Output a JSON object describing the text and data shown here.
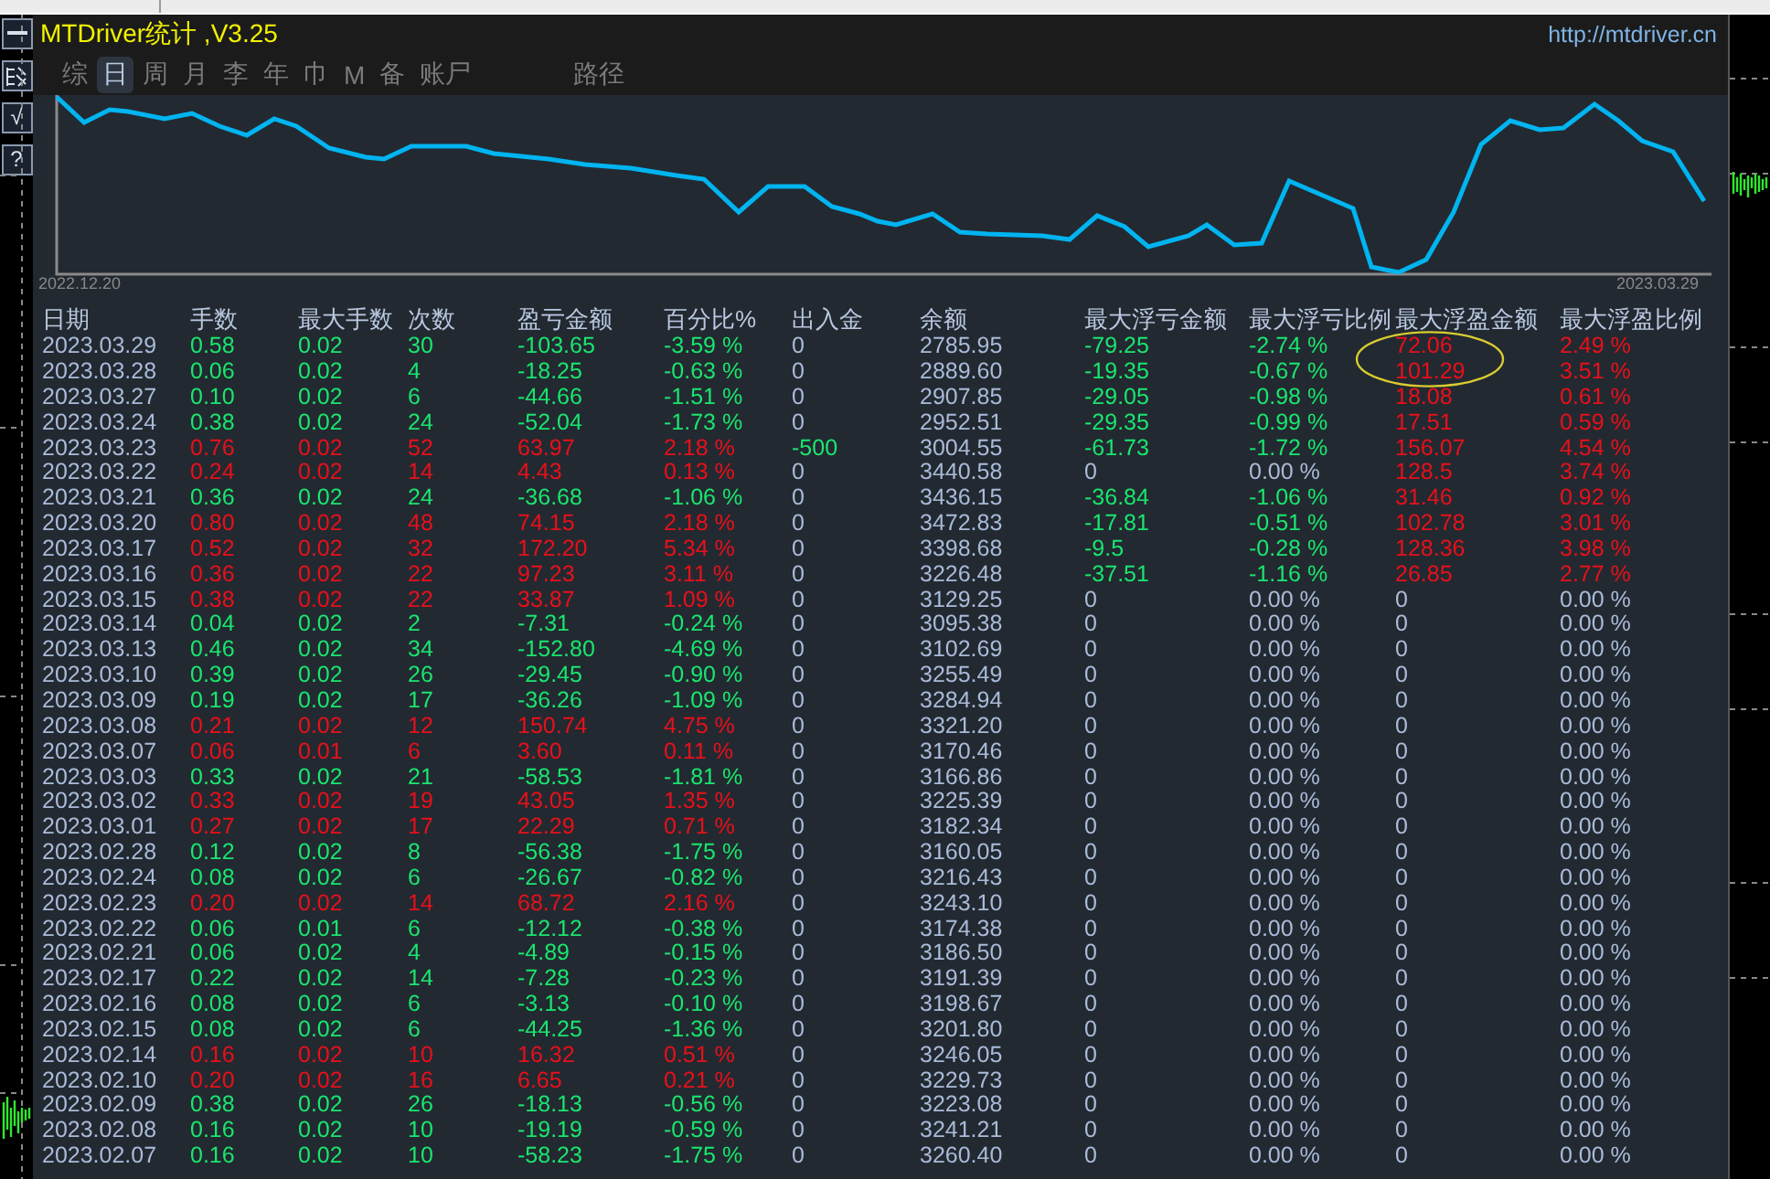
{
  "side_buttons": [
    {
      "kind": "minus"
    },
    {
      "kind": "hatch"
    },
    {
      "kind": "text",
      "label": "√"
    },
    {
      "kind": "text",
      "label": "?"
    }
  ],
  "header": {
    "title": "MTDriver统计 ,V3.25",
    "url": "http://mtdriver.cn"
  },
  "tabs": [
    {
      "label": "综",
      "selected": false
    },
    {
      "label": "日",
      "selected": true
    },
    {
      "label": "周",
      "selected": false
    },
    {
      "label": "月",
      "selected": false
    },
    {
      "label": "李",
      "selected": false
    },
    {
      "label": "年",
      "selected": false
    },
    {
      "label": "巾",
      "selected": false
    },
    {
      "label": "M",
      "selected": false
    },
    {
      "label": "备",
      "selected": false
    },
    {
      "label": "账尸",
      "selected": false
    },
    {
      "label": "路径",
      "selected": false,
      "kind": "far"
    }
  ],
  "chart": {
    "start_label": "2022.12.20",
    "end_label": "2023.03.29"
  },
  "table": {
    "columns": [
      "日期",
      "手数",
      "最大手数",
      "次数",
      "盈亏金额",
      "百分比%",
      "出入金",
      "余额",
      "最大浮亏金额",
      "最大浮亏比例",
      "最大浮盈金额",
      "最大浮盈比例"
    ],
    "rows": [
      {
        "cells": [
          "2023.03.29",
          "0.58",
          "0.02",
          "30",
          "-103.65",
          "-3.59 %",
          "0",
          "2785.95",
          "-79.25",
          "-2.74 %",
          "72.06",
          "2.49 %"
        ],
        "gain": false,
        "cash_moved": false,
        "float_loss_shown": true,
        "float_profit_shown": true
      },
      {
        "cells": [
          "2023.03.28",
          "0.06",
          "0.02",
          "4",
          "-18.25",
          "-0.63 %",
          "0",
          "2889.60",
          "-19.35",
          "-0.67 %",
          "101.29",
          "3.51 %"
        ],
        "gain": false,
        "cash_moved": false,
        "float_loss_shown": true,
        "float_profit_shown": true
      },
      {
        "cells": [
          "2023.03.27",
          "0.10",
          "0.02",
          "6",
          "-44.66",
          "-1.51 %",
          "0",
          "2907.85",
          "-29.05",
          "-0.98 %",
          "18.08",
          "0.61 %"
        ],
        "gain": false,
        "cash_moved": false,
        "float_loss_shown": true,
        "float_profit_shown": true
      },
      {
        "cells": [
          "2023.03.24",
          "0.38",
          "0.02",
          "24",
          "-52.04",
          "-1.73 %",
          "0",
          "2952.51",
          "-29.35",
          "-0.99 %",
          "17.51",
          "0.59 %"
        ],
        "gain": false,
        "cash_moved": false,
        "float_loss_shown": true,
        "float_profit_shown": true
      },
      {
        "cells": [
          "2023.03.23",
          "0.76",
          "0.02",
          "52",
          "63.97",
          "2.18 %",
          "-500",
          "3004.55",
          "-61.73",
          "-1.72 %",
          "156.07",
          "4.54 %"
        ],
        "gain": true,
        "cash_moved": true,
        "float_loss_shown": true,
        "float_profit_shown": true
      },
      {
        "cells": [
          "2023.03.22",
          "0.24",
          "0.02",
          "14",
          "4.43",
          "0.13 %",
          "0",
          "3440.58",
          "0",
          "0.00 %",
          "128.5",
          "3.74 %"
        ],
        "gain": true,
        "cash_moved": false,
        "float_loss_shown": false,
        "float_profit_shown": true
      },
      {
        "cells": [
          "2023.03.21",
          "0.36",
          "0.02",
          "24",
          "-36.68",
          "-1.06 %",
          "0",
          "3436.15",
          "-36.84",
          "-1.06 %",
          "31.46",
          "0.92 %"
        ],
        "gain": false,
        "cash_moved": false,
        "float_loss_shown": true,
        "float_profit_shown": true
      },
      {
        "cells": [
          "2023.03.20",
          "0.80",
          "0.02",
          "48",
          "74.15",
          "2.18 %",
          "0",
          "3472.83",
          "-17.81",
          "-0.51 %",
          "102.78",
          "3.01 %"
        ],
        "gain": true,
        "cash_moved": false,
        "float_loss_shown": true,
        "float_profit_shown": true
      },
      {
        "cells": [
          "2023.03.17",
          "0.52",
          "0.02",
          "32",
          "172.20",
          "5.34 %",
          "0",
          "3398.68",
          "-9.5",
          "-0.28 %",
          "128.36",
          "3.98 %"
        ],
        "gain": true,
        "cash_moved": false,
        "float_loss_shown": true,
        "float_profit_shown": true
      },
      {
        "cells": [
          "2023.03.16",
          "0.36",
          "0.02",
          "22",
          "97.23",
          "3.11 %",
          "0",
          "3226.48",
          "-37.51",
          "-1.16 %",
          "26.85",
          "2.77 %"
        ],
        "gain": true,
        "cash_moved": false,
        "float_loss_shown": true,
        "float_profit_shown": true
      },
      {
        "cells": [
          "2023.03.15",
          "0.38",
          "0.02",
          "22",
          "33.87",
          "1.09 %",
          "0",
          "3129.25",
          "0",
          "0.00 %",
          "0",
          "0.00 %"
        ],
        "gain": true,
        "cash_moved": false,
        "float_loss_shown": false,
        "float_profit_shown": false
      },
      {
        "cells": [
          "2023.03.14",
          "0.04",
          "0.02",
          "2",
          "-7.31",
          "-0.24 %",
          "0",
          "3095.38",
          "0",
          "0.00 %",
          "0",
          "0.00 %"
        ],
        "gain": false,
        "cash_moved": false,
        "float_loss_shown": false,
        "float_profit_shown": false
      },
      {
        "cells": [
          "2023.03.13",
          "0.46",
          "0.02",
          "34",
          "-152.80",
          "-4.69 %",
          "0",
          "3102.69",
          "0",
          "0.00 %",
          "0",
          "0.00 %"
        ],
        "gain": false,
        "cash_moved": false,
        "float_loss_shown": false,
        "float_profit_shown": false
      },
      {
        "cells": [
          "2023.03.10",
          "0.39",
          "0.02",
          "26",
          "-29.45",
          "-0.90 %",
          "0",
          "3255.49",
          "0",
          "0.00 %",
          "0",
          "0.00 %"
        ],
        "gain": false,
        "cash_moved": false,
        "float_loss_shown": false,
        "float_profit_shown": false
      },
      {
        "cells": [
          "2023.03.09",
          "0.19",
          "0.02",
          "17",
          "-36.26",
          "-1.09 %",
          "0",
          "3284.94",
          "0",
          "0.00 %",
          "0",
          "0.00 %"
        ],
        "gain": false,
        "cash_moved": false,
        "float_loss_shown": false,
        "float_profit_shown": false
      },
      {
        "cells": [
          "2023.03.08",
          "0.21",
          "0.02",
          "12",
          "150.74",
          "4.75 %",
          "0",
          "3321.20",
          "0",
          "0.00 %",
          "0",
          "0.00 %"
        ],
        "gain": true,
        "cash_moved": false,
        "float_loss_shown": false,
        "float_profit_shown": false
      },
      {
        "cells": [
          "2023.03.07",
          "0.06",
          "0.01",
          "6",
          "3.60",
          "0.11 %",
          "0",
          "3170.46",
          "0",
          "0.00 %",
          "0",
          "0.00 %"
        ],
        "gain": true,
        "cash_moved": false,
        "float_loss_shown": false,
        "float_profit_shown": false
      },
      {
        "cells": [
          "2023.03.03",
          "0.33",
          "0.02",
          "21",
          "-58.53",
          "-1.81 %",
          "0",
          "3166.86",
          "0",
          "0.00 %",
          "0",
          "0.00 %"
        ],
        "gain": false,
        "cash_moved": false,
        "float_loss_shown": false,
        "float_profit_shown": false
      },
      {
        "cells": [
          "2023.03.02",
          "0.33",
          "0.02",
          "19",
          "43.05",
          "1.35 %",
          "0",
          "3225.39",
          "0",
          "0.00 %",
          "0",
          "0.00 %"
        ],
        "gain": true,
        "cash_moved": false,
        "float_loss_shown": false,
        "float_profit_shown": false
      },
      {
        "cells": [
          "2023.03.01",
          "0.27",
          "0.02",
          "17",
          "22.29",
          "0.71 %",
          "0",
          "3182.34",
          "0",
          "0.00 %",
          "0",
          "0.00 %"
        ],
        "gain": true,
        "cash_moved": false,
        "float_loss_shown": false,
        "float_profit_shown": false
      },
      {
        "cells": [
          "2023.02.28",
          "0.12",
          "0.02",
          "8",
          "-56.38",
          "-1.75 %",
          "0",
          "3160.05",
          "0",
          "0.00 %",
          "0",
          "0.00 %"
        ],
        "gain": false,
        "cash_moved": false,
        "float_loss_shown": false,
        "float_profit_shown": false
      },
      {
        "cells": [
          "2023.02.24",
          "0.08",
          "0.02",
          "6",
          "-26.67",
          "-0.82 %",
          "0",
          "3216.43",
          "0",
          "0.00 %",
          "0",
          "0.00 %"
        ],
        "gain": false,
        "cash_moved": false,
        "float_loss_shown": false,
        "float_profit_shown": false
      },
      {
        "cells": [
          "2023.02.23",
          "0.20",
          "0.02",
          "14",
          "68.72",
          "2.16 %",
          "0",
          "3243.10",
          "0",
          "0.00 %",
          "0",
          "0.00 %"
        ],
        "gain": true,
        "cash_moved": false,
        "float_loss_shown": false,
        "float_profit_shown": false
      },
      {
        "cells": [
          "2023.02.22",
          "0.06",
          "0.01",
          "6",
          "-12.12",
          "-0.38 %",
          "0",
          "3174.38",
          "0",
          "0.00 %",
          "0",
          "0.00 %"
        ],
        "gain": false,
        "cash_moved": false,
        "float_loss_shown": false,
        "float_profit_shown": false
      },
      {
        "cells": [
          "2023.02.21",
          "0.06",
          "0.02",
          "4",
          "-4.89",
          "-0.15 %",
          "0",
          "3186.50",
          "0",
          "0.00 %",
          "0",
          "0.00 %"
        ],
        "gain": false,
        "cash_moved": false,
        "float_loss_shown": false,
        "float_profit_shown": false
      },
      {
        "cells": [
          "2023.02.17",
          "0.22",
          "0.02",
          "14",
          "-7.28",
          "-0.23 %",
          "0",
          "3191.39",
          "0",
          "0.00 %",
          "0",
          "0.00 %"
        ],
        "gain": false,
        "cash_moved": false,
        "float_loss_shown": false,
        "float_profit_shown": false
      },
      {
        "cells": [
          "2023.02.16",
          "0.08",
          "0.02",
          "6",
          "-3.13",
          "-0.10 %",
          "0",
          "3198.67",
          "0",
          "0.00 %",
          "0",
          "0.00 %"
        ],
        "gain": false,
        "cash_moved": false,
        "float_loss_shown": false,
        "float_profit_shown": false
      },
      {
        "cells": [
          "2023.02.15",
          "0.08",
          "0.02",
          "6",
          "-44.25",
          "-1.36 %",
          "0",
          "3201.80",
          "0",
          "0.00 %",
          "0",
          "0.00 %"
        ],
        "gain": false,
        "cash_moved": false,
        "float_loss_shown": false,
        "float_profit_shown": false
      },
      {
        "cells": [
          "2023.02.14",
          "0.16",
          "0.02",
          "10",
          "16.32",
          "0.51 %",
          "0",
          "3246.05",
          "0",
          "0.00 %",
          "0",
          "0.00 %"
        ],
        "gain": true,
        "cash_moved": false,
        "float_loss_shown": false,
        "float_profit_shown": false
      },
      {
        "cells": [
          "2023.02.10",
          "0.20",
          "0.02",
          "16",
          "6.65",
          "0.21 %",
          "0",
          "3229.73",
          "0",
          "0.00 %",
          "0",
          "0.00 %"
        ],
        "gain": true,
        "cash_moved": false,
        "float_loss_shown": false,
        "float_profit_shown": false
      },
      {
        "cells": [
          "2023.02.09",
          "0.38",
          "0.02",
          "26",
          "-18.13",
          "-0.56 %",
          "0",
          "3223.08",
          "0",
          "0.00 %",
          "0",
          "0.00 %"
        ],
        "gain": false,
        "cash_moved": false,
        "float_loss_shown": false,
        "float_profit_shown": false
      },
      {
        "cells": [
          "2023.02.08",
          "0.16",
          "0.02",
          "10",
          "-19.19",
          "-0.59 %",
          "0",
          "3241.21",
          "0",
          "0.00 %",
          "0",
          "0.00 %"
        ],
        "gain": false,
        "cash_moved": false,
        "float_loss_shown": false,
        "float_profit_shown": false
      },
      {
        "cells": [
          "2023.02.07",
          "0.16",
          "0.02",
          "10",
          "-58.23",
          "-1.75 %",
          "0",
          "3260.40",
          "0",
          "0.00 %",
          "0",
          "0.00 %"
        ],
        "gain": false,
        "cash_moved": false,
        "float_loss_shown": false,
        "float_profit_shown": false
      }
    ]
  },
  "annotations": [
    {
      "kind": "ellipse"
    }
  ]
}
